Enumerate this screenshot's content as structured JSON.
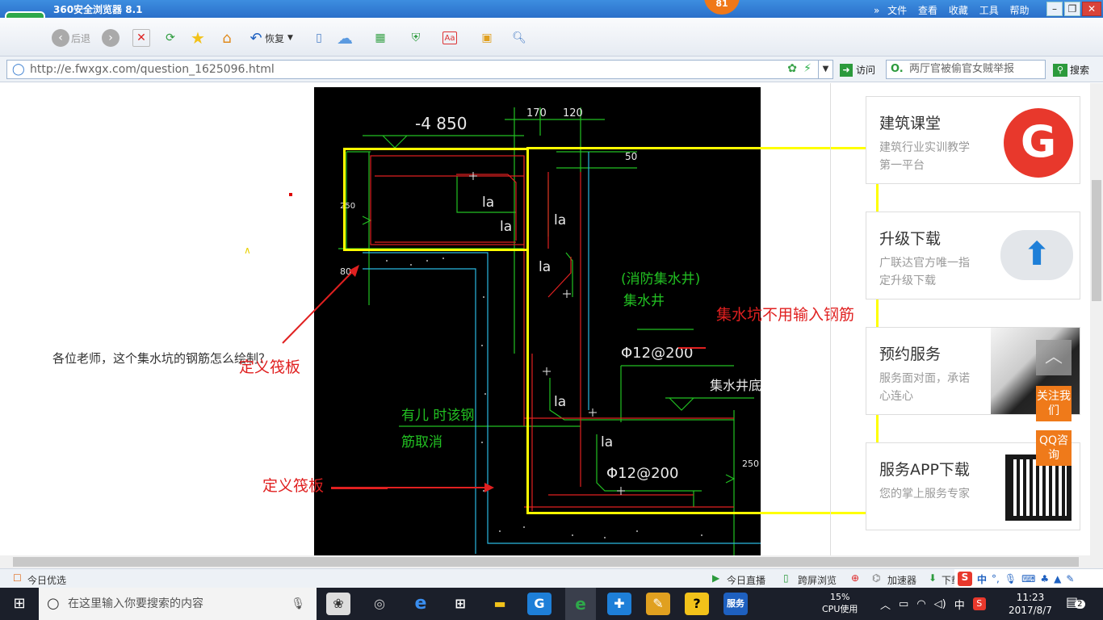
{
  "browser": {
    "title": "360安全浏览器 8.1",
    "badge": "81",
    "menu": [
      "文件",
      "查看",
      "收藏",
      "工具",
      "帮助"
    ]
  },
  "toolbar": {
    "back": "后退",
    "restore": "恢复"
  },
  "address": {
    "url": "http://e.fwxgx.com/question_1625096.html",
    "visit": "访问",
    "search_placeholder": "两厅官被偷官女贼举报",
    "search_button": "搜索"
  },
  "question": {
    "text": "各位老师，这个集水坑的钢筋怎么绘制？"
  },
  "cad": {
    "labels": [
      "-4 850",
      "170",
      "120",
      "50",
      "la",
      "la",
      "la",
      "(消防集水井)",
      "集水井",
      "Φ12@200",
      "集水井底",
      "la",
      "有儿 时该钢",
      "筋取消",
      "Φ12@200",
      "la",
      "250",
      "80",
      "250"
    ],
    "annotations": [
      "集水坑不用输入钢筋",
      "定义筏板",
      "定义筏板"
    ]
  },
  "sidebar": {
    "cards": [
      {
        "title": "建筑课堂",
        "desc": "建筑行业实训教学第一平台",
        "icon": "brand-logo-icon"
      },
      {
        "title": "升级下载",
        "desc": "广联达官方唯一指定升级下载",
        "icon": "cloud-upload-icon"
      },
      {
        "title": "预约服务",
        "desc": "服务面对面，承诺心连心",
        "icon": "handshake-photo"
      },
      {
        "title": "服务APP下载",
        "desc": "您的掌上服务专家",
        "icon": "qr-code-icon"
      }
    ],
    "float": [
      "关注我们",
      "QQ咨询"
    ]
  },
  "statusbar": {
    "left": "今日优选",
    "items": [
      "今日直播",
      "跨屏浏览",
      "加速器",
      "下载"
    ],
    "ime": "中"
  },
  "taskbar": {
    "search": "在这里输入你要搜索的内容",
    "cpu": "15%",
    "cpu_label": "CPU使用",
    "time": "11:23",
    "date": "2017/8/7",
    "ime": "中",
    "notif": "2",
    "service": "服务"
  }
}
